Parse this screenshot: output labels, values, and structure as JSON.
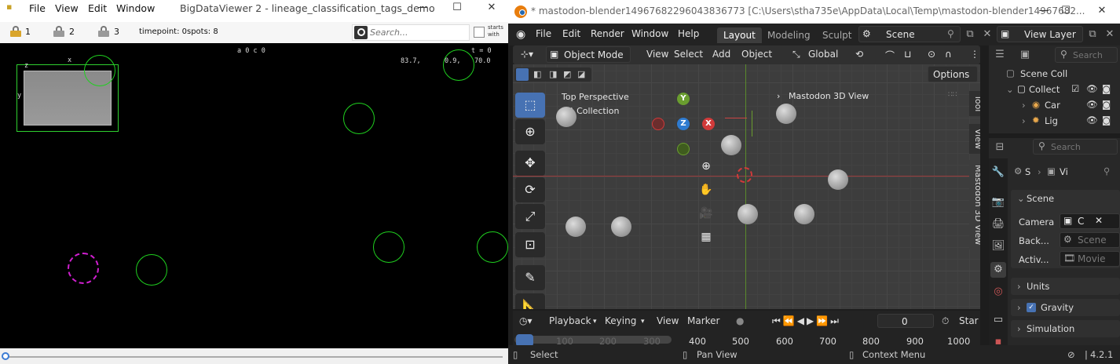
{
  "bdv": {
    "menu": [
      "File",
      "View",
      "Edit",
      "Window"
    ],
    "title": "BigDataViewer 2 - lineage_classification_tags_demo",
    "locks": [
      "1",
      "2",
      "3"
    ],
    "timepoint": "timepoint: 0",
    "spots": "spots: 8",
    "search_placeholder": "Search...",
    "starts_with": "starts with",
    "overlay_axis_x": "x",
    "overlay_axis_y": "y",
    "overlay_axis_z": "z",
    "canvas_top_text": "a 0 c 0",
    "canvas_coord_1": "83.7,",
    "canvas_coord_2": "0.9,",
    "canvas_coord_3": "70.0",
    "canvas_t": "t = 0"
  },
  "blender": {
    "title": "* mastodon-blender14967682296043836773 [C:\\Users\\stha735e\\AppData\\Local\\Temp\\mastodon-blender14967682...",
    "menu": [
      "File",
      "Edit",
      "Render",
      "Window",
      "Help"
    ],
    "workspaces": [
      "Layout",
      "Modeling",
      "Sculpt"
    ],
    "scene_field": "Scene",
    "view_layer_field": "View Layer",
    "header": {
      "mode": "Object Mode",
      "items": [
        "View",
        "Select",
        "Add",
        "Object"
      ],
      "transform": "Global",
      "options": "Options"
    },
    "viewport": {
      "perspective": "Top Perspective",
      "collection": "(0) Collection",
      "addon_label": "Mastodon 3D View"
    },
    "side_tabs": [
      "Tool",
      "View",
      "Mastodon 3D View"
    ],
    "outliner": {
      "search_placeholder": "Search",
      "scene_collection": "Scene Coll",
      "collection": "Collect",
      "camera": "Car",
      "light": "Lig"
    },
    "properties": {
      "search_placeholder": "Search",
      "tab_short_1": "S",
      "tab_short_2": "Vi",
      "section": "Scene",
      "camera_label": "Camera",
      "camera_value": "C",
      "background_label": "Back...",
      "background_value": "Scene",
      "active_label": "Activ...",
      "active_value": "Movie",
      "units": "Units",
      "gravity": "Gravity",
      "simulation": "Simulation"
    },
    "timeline": {
      "items": [
        "Playback",
        "Keying",
        "View",
        "Marker"
      ],
      "current_frame": "0",
      "start_label": "Star",
      "frame_numbers": [
        "100",
        "200",
        "300",
        "400",
        "500",
        "600",
        "700",
        "800",
        "900",
        "1000"
      ]
    },
    "status": {
      "select": "Select",
      "pan": "Pan View",
      "context": "Context Menu",
      "version": "4.2.1"
    }
  }
}
